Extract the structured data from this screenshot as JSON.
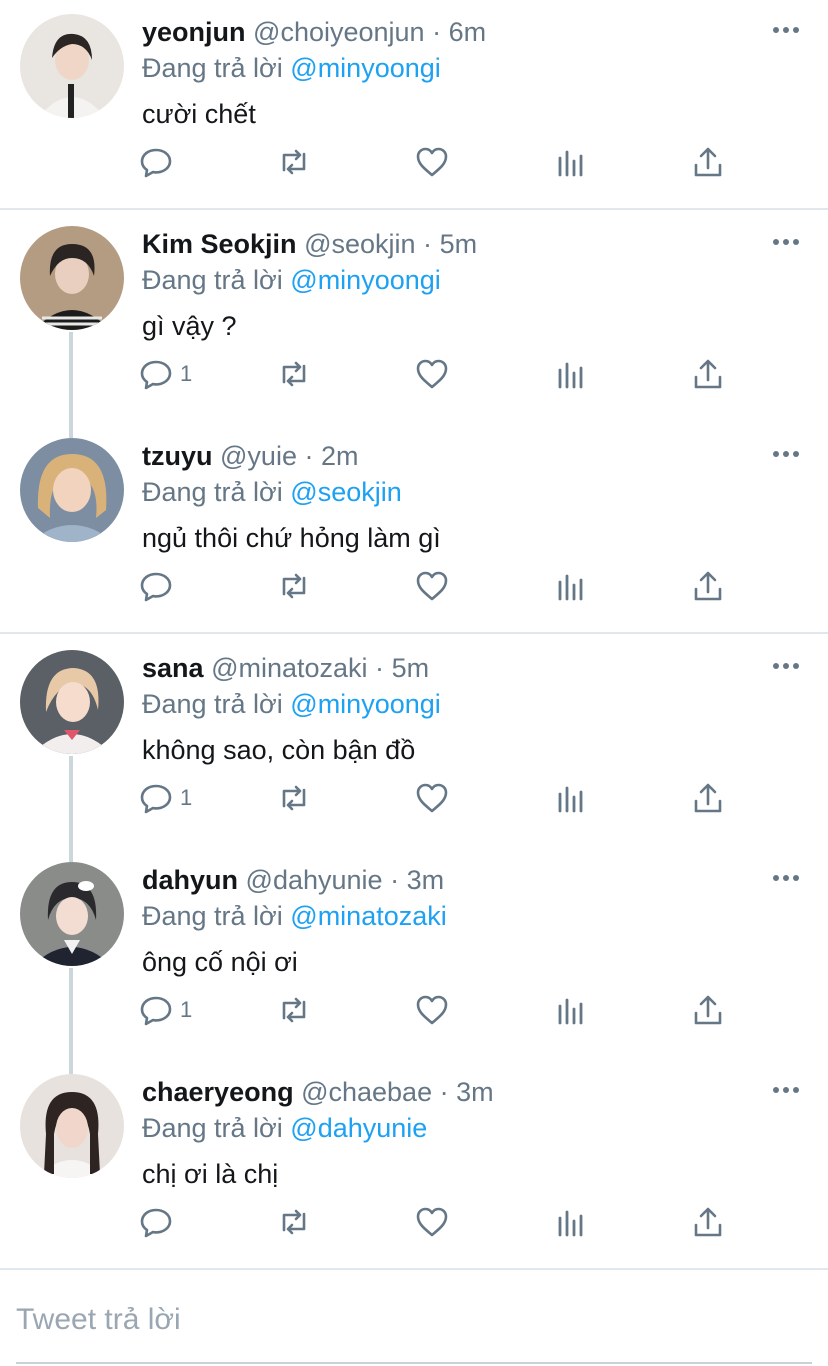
{
  "reply_prefix": "Đang trả lời",
  "tweets": [
    {
      "name": "yeonjun",
      "handle": "@choiyeonjun",
      "time": "6m",
      "reply_to": "@minyoongi",
      "text": "cười chết",
      "replies": "",
      "avatar_colors": {
        "bg": "#e9e6e2",
        "hair": "#2b2624",
        "skin": "#f0d6c6",
        "shirt": "#f4f3f1"
      }
    },
    {
      "name": "Kim Seokjin",
      "handle": "@seokjin",
      "time": "5m",
      "reply_to": "@minyoongi",
      "text": "gì vậy ?",
      "replies": "1",
      "avatar_colors": {
        "bg": "#b49c82",
        "hair": "#2a2522",
        "skin": "#e9cfbf",
        "shirt": "#1c1c1c"
      }
    },
    {
      "name": "tzuyu",
      "handle": "@yuie",
      "time": "2m",
      "reply_to": "@seokjin",
      "text": "ngủ thôi chứ hỏng làm gì",
      "replies": "",
      "avatar_colors": {
        "bg": "#7d8ea3",
        "hair": "#d9b27a",
        "skin": "#f2d3be",
        "shirt": "#9fb4c8"
      }
    },
    {
      "name": "sana",
      "handle": "@minatozaki",
      "time": "5m",
      "reply_to": "@minyoongi",
      "text": "không sao, còn bận đồ",
      "replies": "1",
      "avatar_colors": {
        "bg": "#5b5f66",
        "hair": "#e7c9a8",
        "skin": "#f6dccd",
        "shirt": "#f2eeee"
      }
    },
    {
      "name": "dahyun",
      "handle": "@dahyunie",
      "time": "3m",
      "reply_to": "@minatozaki",
      "text": "ông cố nội ơi",
      "replies": "1",
      "avatar_colors": {
        "bg": "#8a8c8a",
        "hair": "#2a2a2e",
        "skin": "#f3ddd2",
        "shirt": "#1f2430"
      }
    },
    {
      "name": "chaeryeong",
      "handle": "@chaebae",
      "time": "3m",
      "reply_to": "@dahyunie",
      "text": "chị ơi là chị",
      "replies": "",
      "avatar_colors": {
        "bg": "#e7e2de",
        "hair": "#2e2523",
        "skin": "#f1d7cb",
        "shirt": "#f7f5f3"
      }
    }
  ],
  "composer": {
    "placeholder": "Tweet trả lời"
  },
  "colors": {
    "mention": "#1da1f2",
    "muted": "#657786",
    "thread_line": "#ccd6dd",
    "divider": "#e1e8ed"
  }
}
